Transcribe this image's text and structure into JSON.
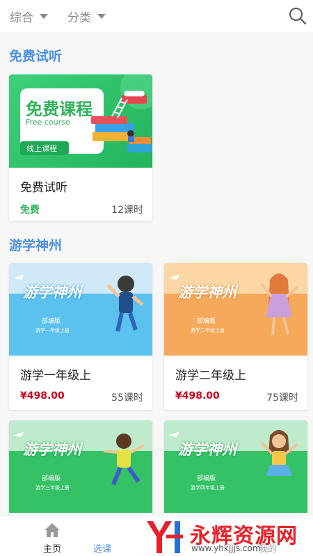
{
  "filters": {
    "comprehensive": "综合",
    "category": "分类"
  },
  "sections": {
    "free": "免费试听",
    "tour": "游学神州"
  },
  "free_card": {
    "banner_title": "免费课程",
    "banner_subtitle": "Free course",
    "banner_tag": "线上课程",
    "title": "免费试听",
    "price": "免费",
    "lessons": "12课时"
  },
  "courses": [
    {
      "banner_title": "游学神州",
      "edition": "部编版",
      "grade_line": "游学一年级上册",
      "title": "游学一年级上",
      "price": "¥498.00",
      "lessons": "55课时"
    },
    {
      "banner_title": "游学神州",
      "edition": "部编版",
      "grade_line": "游学二年级上册",
      "title": "游学二年级上",
      "price": "¥498.00",
      "lessons": "75课时"
    },
    {
      "banner_title": "游学神州",
      "edition": "部编版",
      "grade_line": "游学三年级上册"
    },
    {
      "banner_title": "游学神州",
      "edition": "部编版",
      "grade_line": "游学四年级上册"
    }
  ],
  "nav": {
    "home": "主页",
    "courses": "选课",
    "mine": "我的"
  },
  "watermark": {
    "brand": "永辉资源网",
    "url": "www.yhkjjjs.com"
  },
  "colors": {
    "accent": "#4a90e2",
    "free_green": "#2fb35a",
    "price_red": "#d0021b"
  }
}
